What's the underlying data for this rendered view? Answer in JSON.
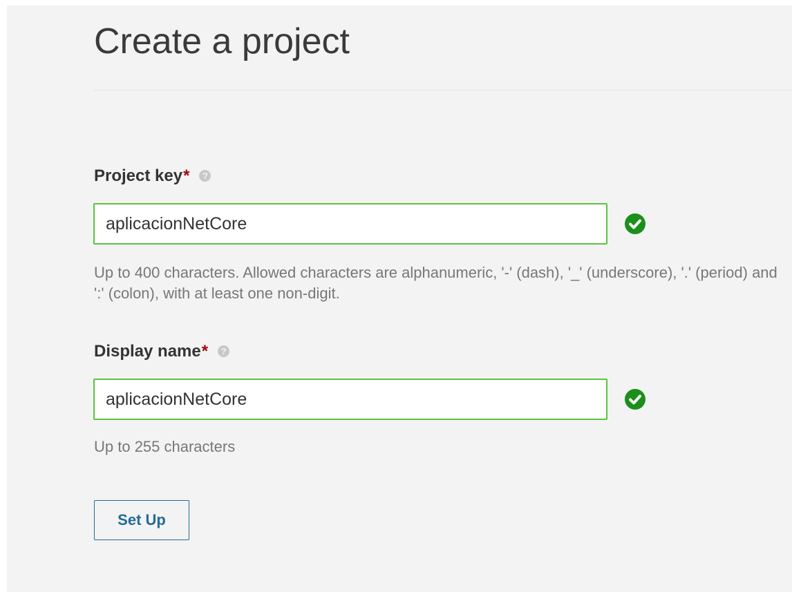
{
  "page": {
    "title": "Create a project"
  },
  "project_key": {
    "label": "Project key",
    "required_mark": "*",
    "help_glyph": "?",
    "value": "aplicacionNetCore",
    "valid_icon": "check-circle-icon",
    "help_text": "Up to 400 characters. Allowed characters are alphanumeric, '-' (dash), '_' (underscore), '.' (period) and ':' (colon), with at least one non-digit."
  },
  "display_name": {
    "label": "Display name",
    "required_mark": "*",
    "help_glyph": "?",
    "value": "aplicacionNetCore",
    "valid_icon": "check-circle-icon",
    "help_text": "Up to 255 characters"
  },
  "actions": {
    "setup_label": "Set Up"
  },
  "colors": {
    "valid_border": "#5bc23f",
    "valid_icon": "#1a8f1a",
    "required": "#a4030f",
    "button": "#236a97"
  }
}
